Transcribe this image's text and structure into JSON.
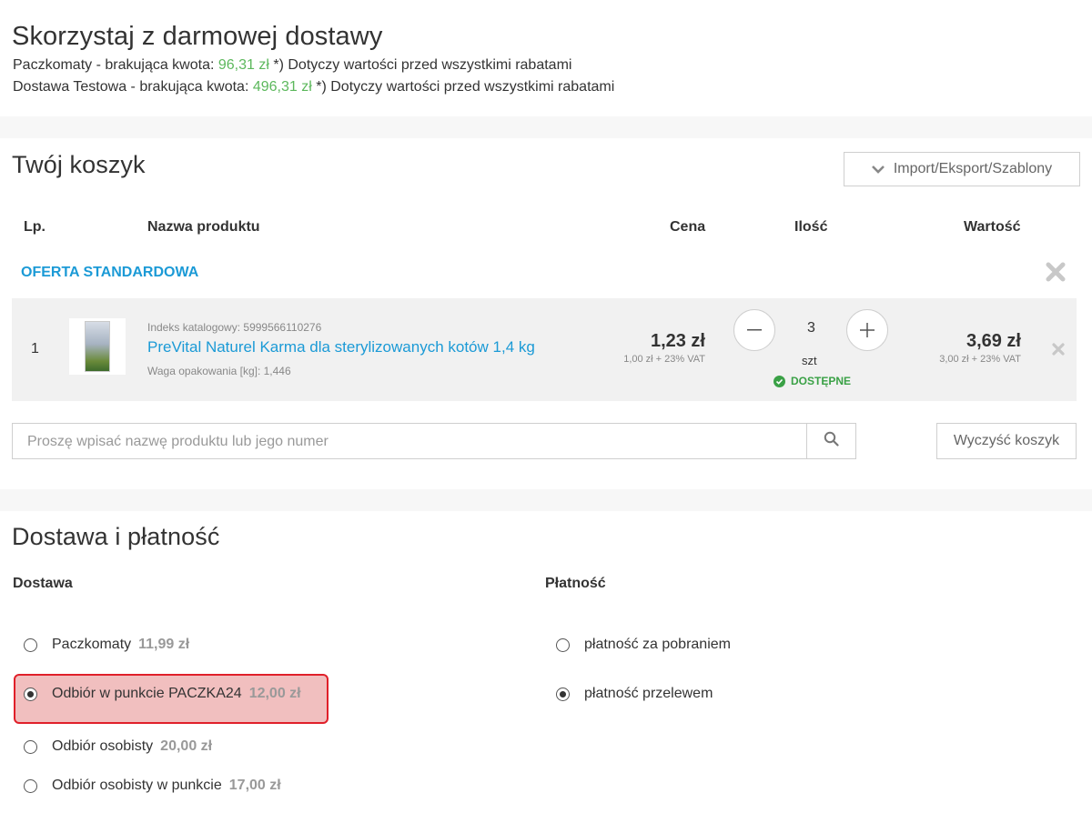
{
  "free_shipping": {
    "title": "Skorzystaj z darmowej dostawy",
    "lines": [
      {
        "label": "Paczkomaty - brakująca kwota:",
        "amount": "96,31 zł",
        "note": "*) Dotyczy wartości przed wszystkimi rabatami"
      },
      {
        "label": "Dostawa Testowa - brakująca kwota:",
        "amount": "496,31 zł",
        "note": "*) Dotyczy wartości przed wszystkimi rabatami"
      }
    ]
  },
  "cart": {
    "title": "Twój koszyk",
    "import_button": "Import/Eksport/Szablony",
    "columns": {
      "lp": "Lp.",
      "name": "Nazwa produktu",
      "price": "Cena",
      "qty": "Ilość",
      "value": "Wartość"
    },
    "offer_label": "OFERTA STANDARDOWA",
    "items": [
      {
        "lp": "1",
        "catalog_index": "Indeks katalogowy: 5999566110276",
        "name": "PreVital Naturel Karma dla sterylizowanych kotów 1,4 kg",
        "weight": "Waga opakowania [kg]: 1,446",
        "price": "1,23 zł",
        "price_vat": "1,00 zł + 23% VAT",
        "quantity": "3",
        "unit": "szt",
        "availability": "DOSTĘPNE",
        "value": "3,69 zł",
        "value_vat": "3,00 zł + 23% VAT"
      }
    ],
    "search_placeholder": "Proszę wpisać nazwę produktu lub jego numer",
    "clear_button": "Wyczyść koszyk"
  },
  "delivery": {
    "title": "Dostawa i płatność",
    "shipping_heading": "Dostawa",
    "payment_heading": "Płatność",
    "shipping_options": [
      {
        "label": "Paczkomaty",
        "price": "11,99 zł",
        "selected": false
      },
      {
        "label": "Odbiór w punkcie PACZKA24",
        "price": "12,00 zł",
        "selected": true
      },
      {
        "label": "Odbiór osobisty",
        "price": "20,00 zł",
        "selected": false
      },
      {
        "label": "Odbiór osobisty w punkcie",
        "price": "17,00 zł",
        "selected": false
      }
    ],
    "payment_options": [
      {
        "label": "płatność za pobraniem",
        "selected": false
      },
      {
        "label": "płatność przelewem",
        "selected": true
      }
    ]
  },
  "colors": {
    "accent": "#1b9ad6",
    "success": "#3aa146",
    "highlight": "#e0202a"
  }
}
